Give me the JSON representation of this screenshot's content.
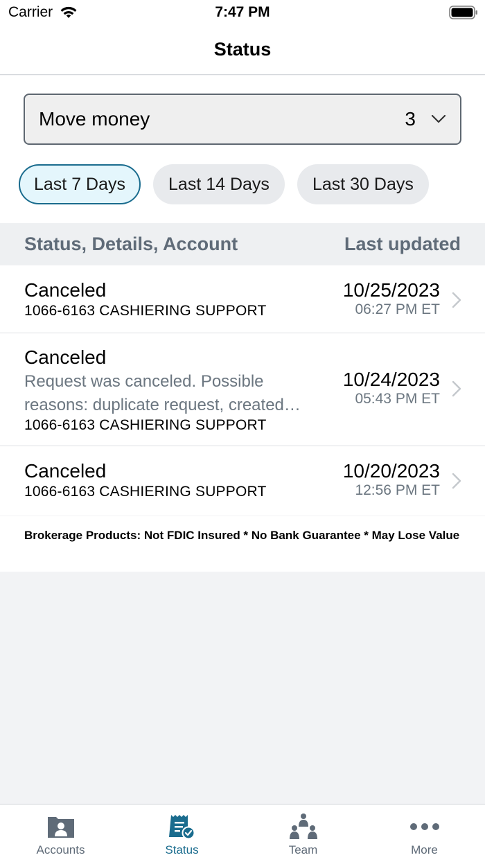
{
  "status_bar": {
    "carrier": "Carrier",
    "time": "7:47 PM"
  },
  "nav": {
    "title": "Status"
  },
  "filter": {
    "select_label": "Move money",
    "select_count": "3",
    "chips": [
      {
        "label": "Last 7 Days",
        "active": true
      },
      {
        "label": "Last 14 Days",
        "active": false
      },
      {
        "label": "Last 30 Days",
        "active": false
      }
    ]
  },
  "table": {
    "col_left": "Status, Details, Account",
    "col_right": "Last updated",
    "rows": [
      {
        "status": "Canceled",
        "details": "",
        "account": "1066-6163 CASHIERING SUPPORT",
        "date": "10/25/2023",
        "time": "06:27 PM ET"
      },
      {
        "status": "Canceled",
        "details": "Request was canceled. Possible reasons: duplicate request, created…",
        "account": "1066-6163 CASHIERING SUPPORT",
        "date": "10/24/2023",
        "time": "05:43 PM ET"
      },
      {
        "status": "Canceled",
        "details": "",
        "account": "1066-6163 CASHIERING SUPPORT",
        "date": "10/20/2023",
        "time": "12:56 PM ET"
      }
    ]
  },
  "disclaimer": "Brokerage Products: Not FDIC Insured * No Bank Guarantee * May Lose Value",
  "tabs": [
    {
      "label": "Accounts",
      "icon": "accounts-folder-icon"
    },
    {
      "label": "Status",
      "icon": "status-receipt-icon"
    },
    {
      "label": "Team",
      "icon": "team-icon"
    },
    {
      "label": "More",
      "icon": "more-dots-icon"
    }
  ],
  "colors": {
    "accent": "#1a6c8e",
    "muted": "#5f6b78"
  }
}
